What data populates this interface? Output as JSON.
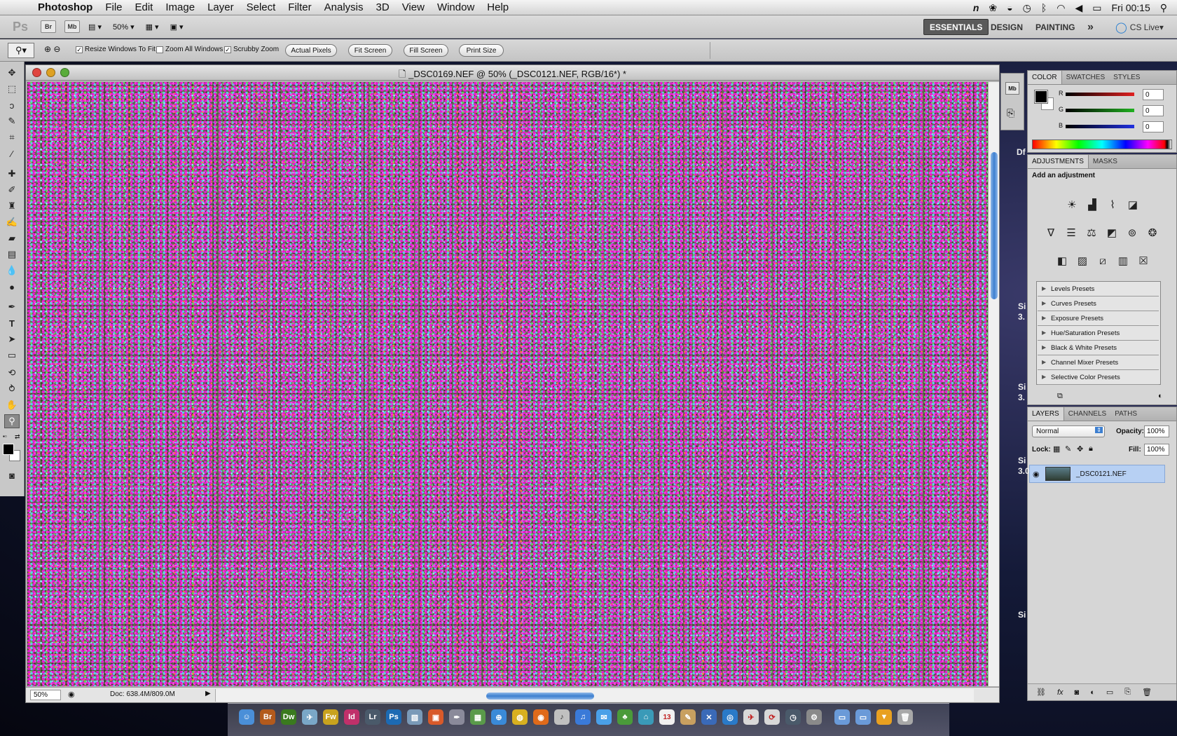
{
  "menubar": {
    "app_name": "Photoshop",
    "items": [
      "File",
      "Edit",
      "Image",
      "Layer",
      "Select",
      "Filter",
      "Analysis",
      "3D",
      "View",
      "Window",
      "Help"
    ],
    "clock": "Fri 00:15"
  },
  "appbar": {
    "logo": "Ps",
    "bridge": "Br",
    "minibridge": "Mb",
    "zoom": "50%",
    "workspaces": {
      "essentials": "ESSENTIALS",
      "design": "DESIGN",
      "painting": "PAINTING",
      "more": "»",
      "cs_live": "CS Live"
    }
  },
  "options": {
    "resize_windows": "Resize Windows To Fit",
    "zoom_all": "Zoom All Windows",
    "scrubby": "Scrubby Zoom",
    "actual_pixels": "Actual Pixels",
    "fit_screen": "Fit Screen",
    "fill_screen": "Fill Screen",
    "print_size": "Print Size",
    "checked": {
      "resize_windows": true,
      "zoom_all": false,
      "scrubby": true
    }
  },
  "document": {
    "title": "_DSC0169.NEF @ 50% (_DSC0121.NEF, RGB/16*) *",
    "zoom": "50%",
    "doc_size": "Doc: 638.4M/809.0M"
  },
  "color_panel": {
    "tabs": [
      "COLOR",
      "SWATCHES",
      "STYLES"
    ],
    "channels": [
      {
        "label": "R",
        "value": "0",
        "color": "#e02020"
      },
      {
        "label": "G",
        "value": "0",
        "color": "#20b020"
      },
      {
        "label": "B",
        "value": "0",
        "color": "#2030e0"
      }
    ]
  },
  "adjustments_panel": {
    "tabs": [
      "ADJUSTMENTS",
      "MASKS"
    ],
    "heading": "Add an adjustment",
    "presets": [
      "Levels Presets",
      "Curves Presets",
      "Exposure Presets",
      "Hue/Saturation Presets",
      "Black & White Presets",
      "Channel Mixer Presets",
      "Selective Color Presets"
    ]
  },
  "layers_panel": {
    "tabs": [
      "LAYERS",
      "CHANNELS",
      "PATHS"
    ],
    "blend_mode": "Normal",
    "opacity_label": "Opacity:",
    "opacity": "100%",
    "lock_label": "Lock:",
    "fill_label": "Fill:",
    "fill": "100%",
    "layers": [
      {
        "name": "_DSC0121.NEF",
        "visible": true
      }
    ]
  },
  "desktop": {
    "labels": [
      "Df",
      "Si",
      "3.",
      "Si",
      "3.",
      "Si",
      "3.0",
      "Si"
    ]
  },
  "dock": {
    "apps": [
      {
        "label": "Br",
        "color": "#b35a1c"
      },
      {
        "label": "Dw",
        "color": "#3a7a1e"
      },
      {
        "label": "Fw",
        "color": "#c8a21e"
      },
      {
        "label": "Id",
        "color": "#c0306a"
      },
      {
        "label": "Lr",
        "color": "#4a5a6a"
      },
      {
        "label": "Ps",
        "color": "#1c6ab3"
      }
    ],
    "calendar_day": "13"
  },
  "colors": {
    "accent_blue": "#3d7fd0",
    "layer_selected": "#b7d0f3",
    "noise_magenta": "#e61ad0",
    "noise_cyan": "#5ecbe8",
    "noise_green": "#60d260"
  }
}
